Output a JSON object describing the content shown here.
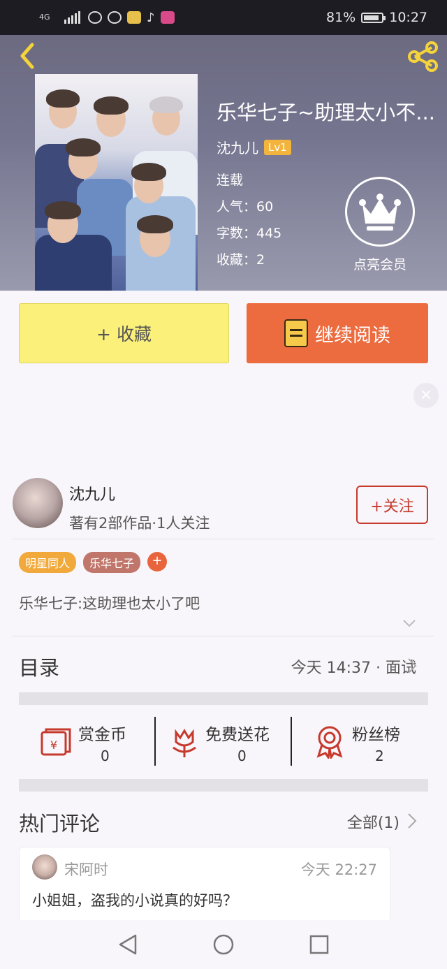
{
  "status_bar": {
    "network": "4G",
    "battery": "81%",
    "time": "10:27"
  },
  "header": {
    "title": "乐华七子~助理太小不...",
    "author": "沈九儿",
    "level": "Lv1",
    "serial_status": "连载",
    "popularity": "人气：60",
    "word_count": "字数：445",
    "favorites": "收藏：2",
    "vip_label": "点亮会员"
  },
  "actions": {
    "favorite_label": "+ 收藏",
    "read_label": "继续阅读"
  },
  "ad": {
    "close": "×"
  },
  "author_card": {
    "name": "沈九儿",
    "info": "著有2部作品·1人关注",
    "follow_label": "+关注"
  },
  "tags": [
    {
      "label": "明星同人",
      "color": "#f2a93b"
    },
    {
      "label": "乐华七子",
      "color": "#c0766a"
    }
  ],
  "tag_add": "+",
  "description": "乐华七子:这助理也太小了吧",
  "toc": {
    "title": "目录",
    "latest": "今天 14:37 · 面试"
  },
  "stats": [
    {
      "label": "赏金币",
      "value": "0",
      "icon": "red-envelope-icon"
    },
    {
      "label": "免费送花",
      "value": "0",
      "icon": "flower-icon"
    },
    {
      "label": "粉丝榜",
      "value": "2",
      "icon": "medal-icon"
    }
  ],
  "comments": {
    "title": "热门评论",
    "all_label": "全部(1)",
    "items": [
      {
        "user": "宋阿时",
        "time": "今天 22:27",
        "text": "小姐姐，盗我的小说真的好吗？"
      }
    ]
  },
  "colors": {
    "accent_orange": "#ec6b3f",
    "favorite_yellow": "#fbf07a",
    "follow_red": "#c63a2e",
    "level_badge": "#f2b43c"
  }
}
